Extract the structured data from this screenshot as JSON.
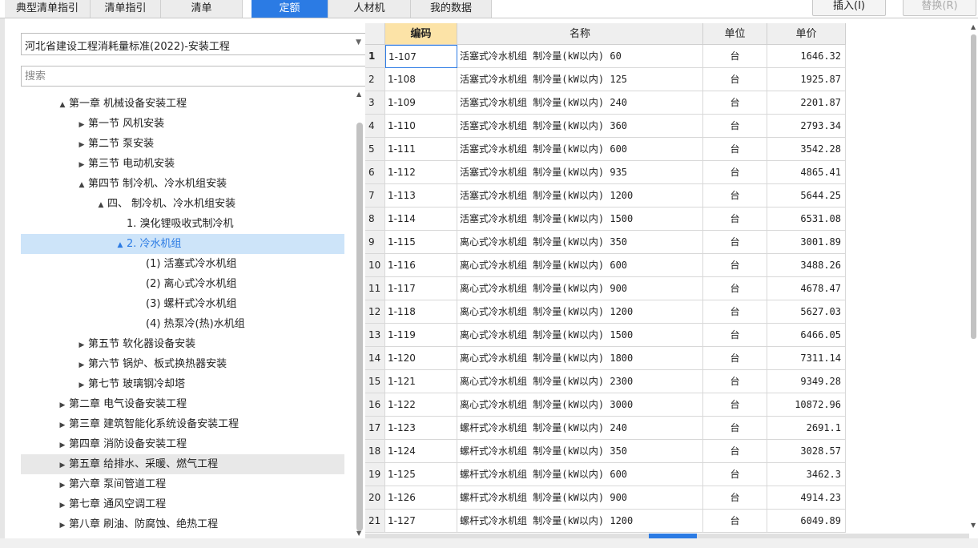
{
  "tabs": [
    {
      "label": "典型清单指引",
      "active": false
    },
    {
      "label": "清单指引",
      "active": false
    },
    {
      "label": "清单",
      "active": false
    },
    {
      "label": "定额",
      "active": true
    },
    {
      "label": "人材机",
      "active": false
    },
    {
      "label": "我的数据",
      "active": false
    }
  ],
  "toolbar": {
    "insert_label": "插入(I)",
    "replace_label": "替换(R)"
  },
  "library": {
    "selected": "河北省建设工程消耗量标准(2022)-安装工程"
  },
  "search": {
    "placeholder": "搜索",
    "value": ""
  },
  "tree": [
    {
      "label": "第一章 机械设备安装工程",
      "expanded": true,
      "has_children": true
    },
    {
      "label": "第一节 风机安装",
      "expanded": false,
      "has_children": true
    },
    {
      "label": "第二节 泵安装",
      "expanded": false,
      "has_children": true
    },
    {
      "label": "第三节 电动机安装",
      "expanded": false,
      "has_children": true
    },
    {
      "label": "第四节 制冷机、冷水机组安装",
      "expanded": true,
      "has_children": true
    },
    {
      "label": "四、 制冷机、冷水机组安装",
      "expanded": true,
      "has_children": true
    },
    {
      "label": "1. 溴化锂吸收式制冷机",
      "has_children": false
    },
    {
      "label": "2. 冷水机组",
      "expanded": true,
      "has_children": true,
      "selected": true
    },
    {
      "label": "(1) 活塞式冷水机组",
      "has_children": false
    },
    {
      "label": "(2) 离心式冷水机组",
      "has_children": false
    },
    {
      "label": "(3) 螺杆式冷水机组",
      "has_children": false
    },
    {
      "label": "(4) 热泵冷(热)水机组",
      "has_children": false
    },
    {
      "label": "第五节 软化器设备安装",
      "expanded": false,
      "has_children": true
    },
    {
      "label": "第六节 锅炉、板式换热器安装",
      "expanded": false,
      "has_children": true
    },
    {
      "label": "第七节 玻璃钢冷却塔",
      "expanded": false,
      "has_children": true
    },
    {
      "label": "第二章 电气设备安装工程",
      "expanded": false,
      "has_children": true
    },
    {
      "label": "第三章 建筑智能化系统设备安装工程",
      "expanded": false,
      "has_children": true
    },
    {
      "label": "第四章 消防设备安装工程",
      "expanded": false,
      "has_children": true
    },
    {
      "label": "第五章 给排水、采暖、燃气工程",
      "expanded": false,
      "has_children": true,
      "hovered": true
    },
    {
      "label": "第六章 泵间管道工程",
      "expanded": false,
      "has_children": true
    },
    {
      "label": "第七章 通风空调工程",
      "expanded": false,
      "has_children": true
    },
    {
      "label": "第八章 刷油、防腐蚀、绝热工程",
      "expanded": false,
      "has_children": true
    }
  ],
  "grid": {
    "headers": {
      "code": "编码",
      "name": "名称",
      "unit": "单位",
      "price": "单价"
    },
    "rows": [
      {
        "no": "1",
        "code": "1-107",
        "name": "活塞式冷水机组 制冷量(kW以内) 60",
        "unit": "台",
        "price": "1646.32"
      },
      {
        "no": "2",
        "code": "1-108",
        "name": "活塞式冷水机组 制冷量(kW以内) 125",
        "unit": "台",
        "price": "1925.87"
      },
      {
        "no": "3",
        "code": "1-109",
        "name": "活塞式冷水机组 制冷量(kW以内) 240",
        "unit": "台",
        "price": "2201.87"
      },
      {
        "no": "4",
        "code": "1-110",
        "name": "活塞式冷水机组 制冷量(kW以内) 360",
        "unit": "台",
        "price": "2793.34"
      },
      {
        "no": "5",
        "code": "1-111",
        "name": "活塞式冷水机组 制冷量(kW以内) 600",
        "unit": "台",
        "price": "3542.28"
      },
      {
        "no": "6",
        "code": "1-112",
        "name": "活塞式冷水机组 制冷量(kW以内) 935",
        "unit": "台",
        "price": "4865.41"
      },
      {
        "no": "7",
        "code": "1-113",
        "name": "活塞式冷水机组 制冷量(kW以内) 1200",
        "unit": "台",
        "price": "5644.25"
      },
      {
        "no": "8",
        "code": "1-114",
        "name": "活塞式冷水机组 制冷量(kW以内) 1500",
        "unit": "台",
        "price": "6531.08"
      },
      {
        "no": "9",
        "code": "1-115",
        "name": "离心式冷水机组 制冷量(kW以内) 350",
        "unit": "台",
        "price": "3001.89"
      },
      {
        "no": "10",
        "code": "1-116",
        "name": "离心式冷水机组 制冷量(kW以内) 600",
        "unit": "台",
        "price": "3488.26"
      },
      {
        "no": "11",
        "code": "1-117",
        "name": "离心式冷水机组 制冷量(kW以内) 900",
        "unit": "台",
        "price": "4678.47"
      },
      {
        "no": "12",
        "code": "1-118",
        "name": "离心式冷水机组 制冷量(kW以内) 1200",
        "unit": "台",
        "price": "5627.03"
      },
      {
        "no": "13",
        "code": "1-119",
        "name": "离心式冷水机组 制冷量(kW以内) 1500",
        "unit": "台",
        "price": "6466.05"
      },
      {
        "no": "14",
        "code": "1-120",
        "name": "离心式冷水机组 制冷量(kW以内) 1800",
        "unit": "台",
        "price": "7311.14"
      },
      {
        "no": "15",
        "code": "1-121",
        "name": "离心式冷水机组 制冷量(kW以内) 2300",
        "unit": "台",
        "price": "9349.28"
      },
      {
        "no": "16",
        "code": "1-122",
        "name": "离心式冷水机组 制冷量(kW以内) 3000",
        "unit": "台",
        "price": "10872.96"
      },
      {
        "no": "17",
        "code": "1-123",
        "name": "螺杆式冷水机组 制冷量(kW以内) 240",
        "unit": "台",
        "price": "2691.1"
      },
      {
        "no": "18",
        "code": "1-124",
        "name": "螺杆式冷水机组 制冷量(kW以内) 350",
        "unit": "台",
        "price": "3028.57"
      },
      {
        "no": "19",
        "code": "1-125",
        "name": "螺杆式冷水机组 制冷量(kW以内) 600",
        "unit": "台",
        "price": "3462.3"
      },
      {
        "no": "20",
        "code": "1-126",
        "name": "螺杆式冷水机组 制冷量(kW以内) 900",
        "unit": "台",
        "price": "4914.23"
      },
      {
        "no": "21",
        "code": "1-127",
        "name": "螺杆式冷水机组 制冷量(kW以内) 1200",
        "unit": "台",
        "price": "6049.89"
      }
    ]
  },
  "icons": {
    "expanded": "▲",
    "collapsed": "▶",
    "dropdown": "▼"
  },
  "colors": {
    "accent": "#2b7be4",
    "selected_bg": "#cde4f9",
    "code_header": "#fce3a7"
  }
}
